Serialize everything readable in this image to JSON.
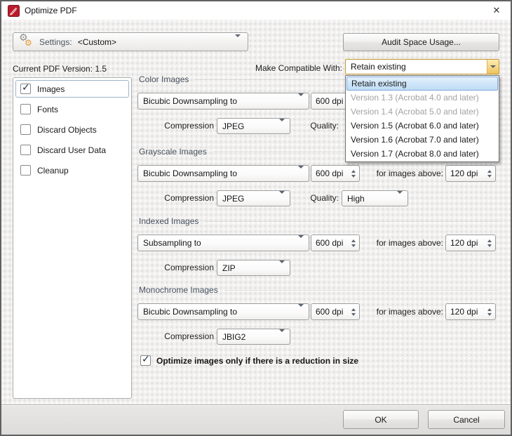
{
  "window": {
    "title": "Optimize PDF"
  },
  "icons": {
    "titlebar": "pdf-pen-icon",
    "close": "close-icon",
    "settings": "gears-icon",
    "combo_arrow": "chevron-down-icon",
    "spinner_arrows": "up-down-arrows-icon",
    "checkbox_check": "checkmark-icon"
  },
  "colors": {
    "title_icon_red": "#bb1b2b",
    "focus_gold_border": "#c2992f",
    "selection_blue": "#cfe6f9",
    "section_caption": "#46525e",
    "dialog_bg": "#f1f0ef"
  },
  "toolbar": {
    "settings_label": "Settings:",
    "settings_value": "<Custom>",
    "audit_button": "Audit Space Usage..."
  },
  "header": {
    "current_version": "Current PDF Version: 1.5",
    "compat_label": "Make Compatible With:",
    "compat_value": "Retain existing"
  },
  "compat_dropdown": {
    "items": [
      {
        "label": "Retain existing",
        "state": "selected"
      },
      {
        "label": "Version 1.3 (Acrobat 4.0 and later)",
        "state": "disabled"
      },
      {
        "label": "Version 1.4 (Acrobat 5.0 and later)",
        "state": "disabled"
      },
      {
        "label": "Version 1.5 (Acrobat 6.0 and later)",
        "state": "normal"
      },
      {
        "label": "Version 1.6 (Acrobat 7.0 and later)",
        "state": "normal"
      },
      {
        "label": "Version 1.7 (Acrobat 8.0 and later)",
        "state": "normal"
      }
    ]
  },
  "sidebar": {
    "items": [
      {
        "label": "Images",
        "checked": true,
        "selected": true
      },
      {
        "label": "Fonts",
        "checked": false,
        "selected": false
      },
      {
        "label": "Discard Objects",
        "checked": false,
        "selected": false
      },
      {
        "label": "Discard User Data",
        "checked": false,
        "selected": false
      },
      {
        "label": "Cleanup",
        "checked": false,
        "selected": false
      }
    ]
  },
  "sections": [
    {
      "title": "Color Images",
      "method": "Bicubic Downsampling to",
      "dpi": "600 dpi",
      "above_label": null,
      "above_value": null,
      "compression_label": "Compression",
      "compression": "JPEG",
      "quality_label": "Quality:",
      "quality": null
    },
    {
      "title": "Grayscale Images",
      "method": "Bicubic Downsampling to",
      "dpi": "600 dpi",
      "above_label": "for images above:",
      "above_value": "120 dpi",
      "compression_label": "Compression",
      "compression": "JPEG",
      "quality_label": "Quality:",
      "quality": "High"
    },
    {
      "title": "Indexed Images",
      "method": "Subsampling to",
      "dpi": "600 dpi",
      "above_label": "for images above:",
      "above_value": "120 dpi",
      "compression_label": "Compression",
      "compression": "ZIP",
      "quality_label": null,
      "quality": null
    },
    {
      "title": "Monochrome Images",
      "method": "Bicubic Downsampling to",
      "dpi": "600 dpi",
      "above_label": "for images above:",
      "above_value": "120 dpi",
      "compression_label": "Compression",
      "compression": "JBIG2",
      "quality_label": null,
      "quality": null
    }
  ],
  "footer": {
    "optimize_checkbox": "Optimize images only if there is a reduction in size",
    "ok": "OK",
    "cancel": "Cancel"
  }
}
